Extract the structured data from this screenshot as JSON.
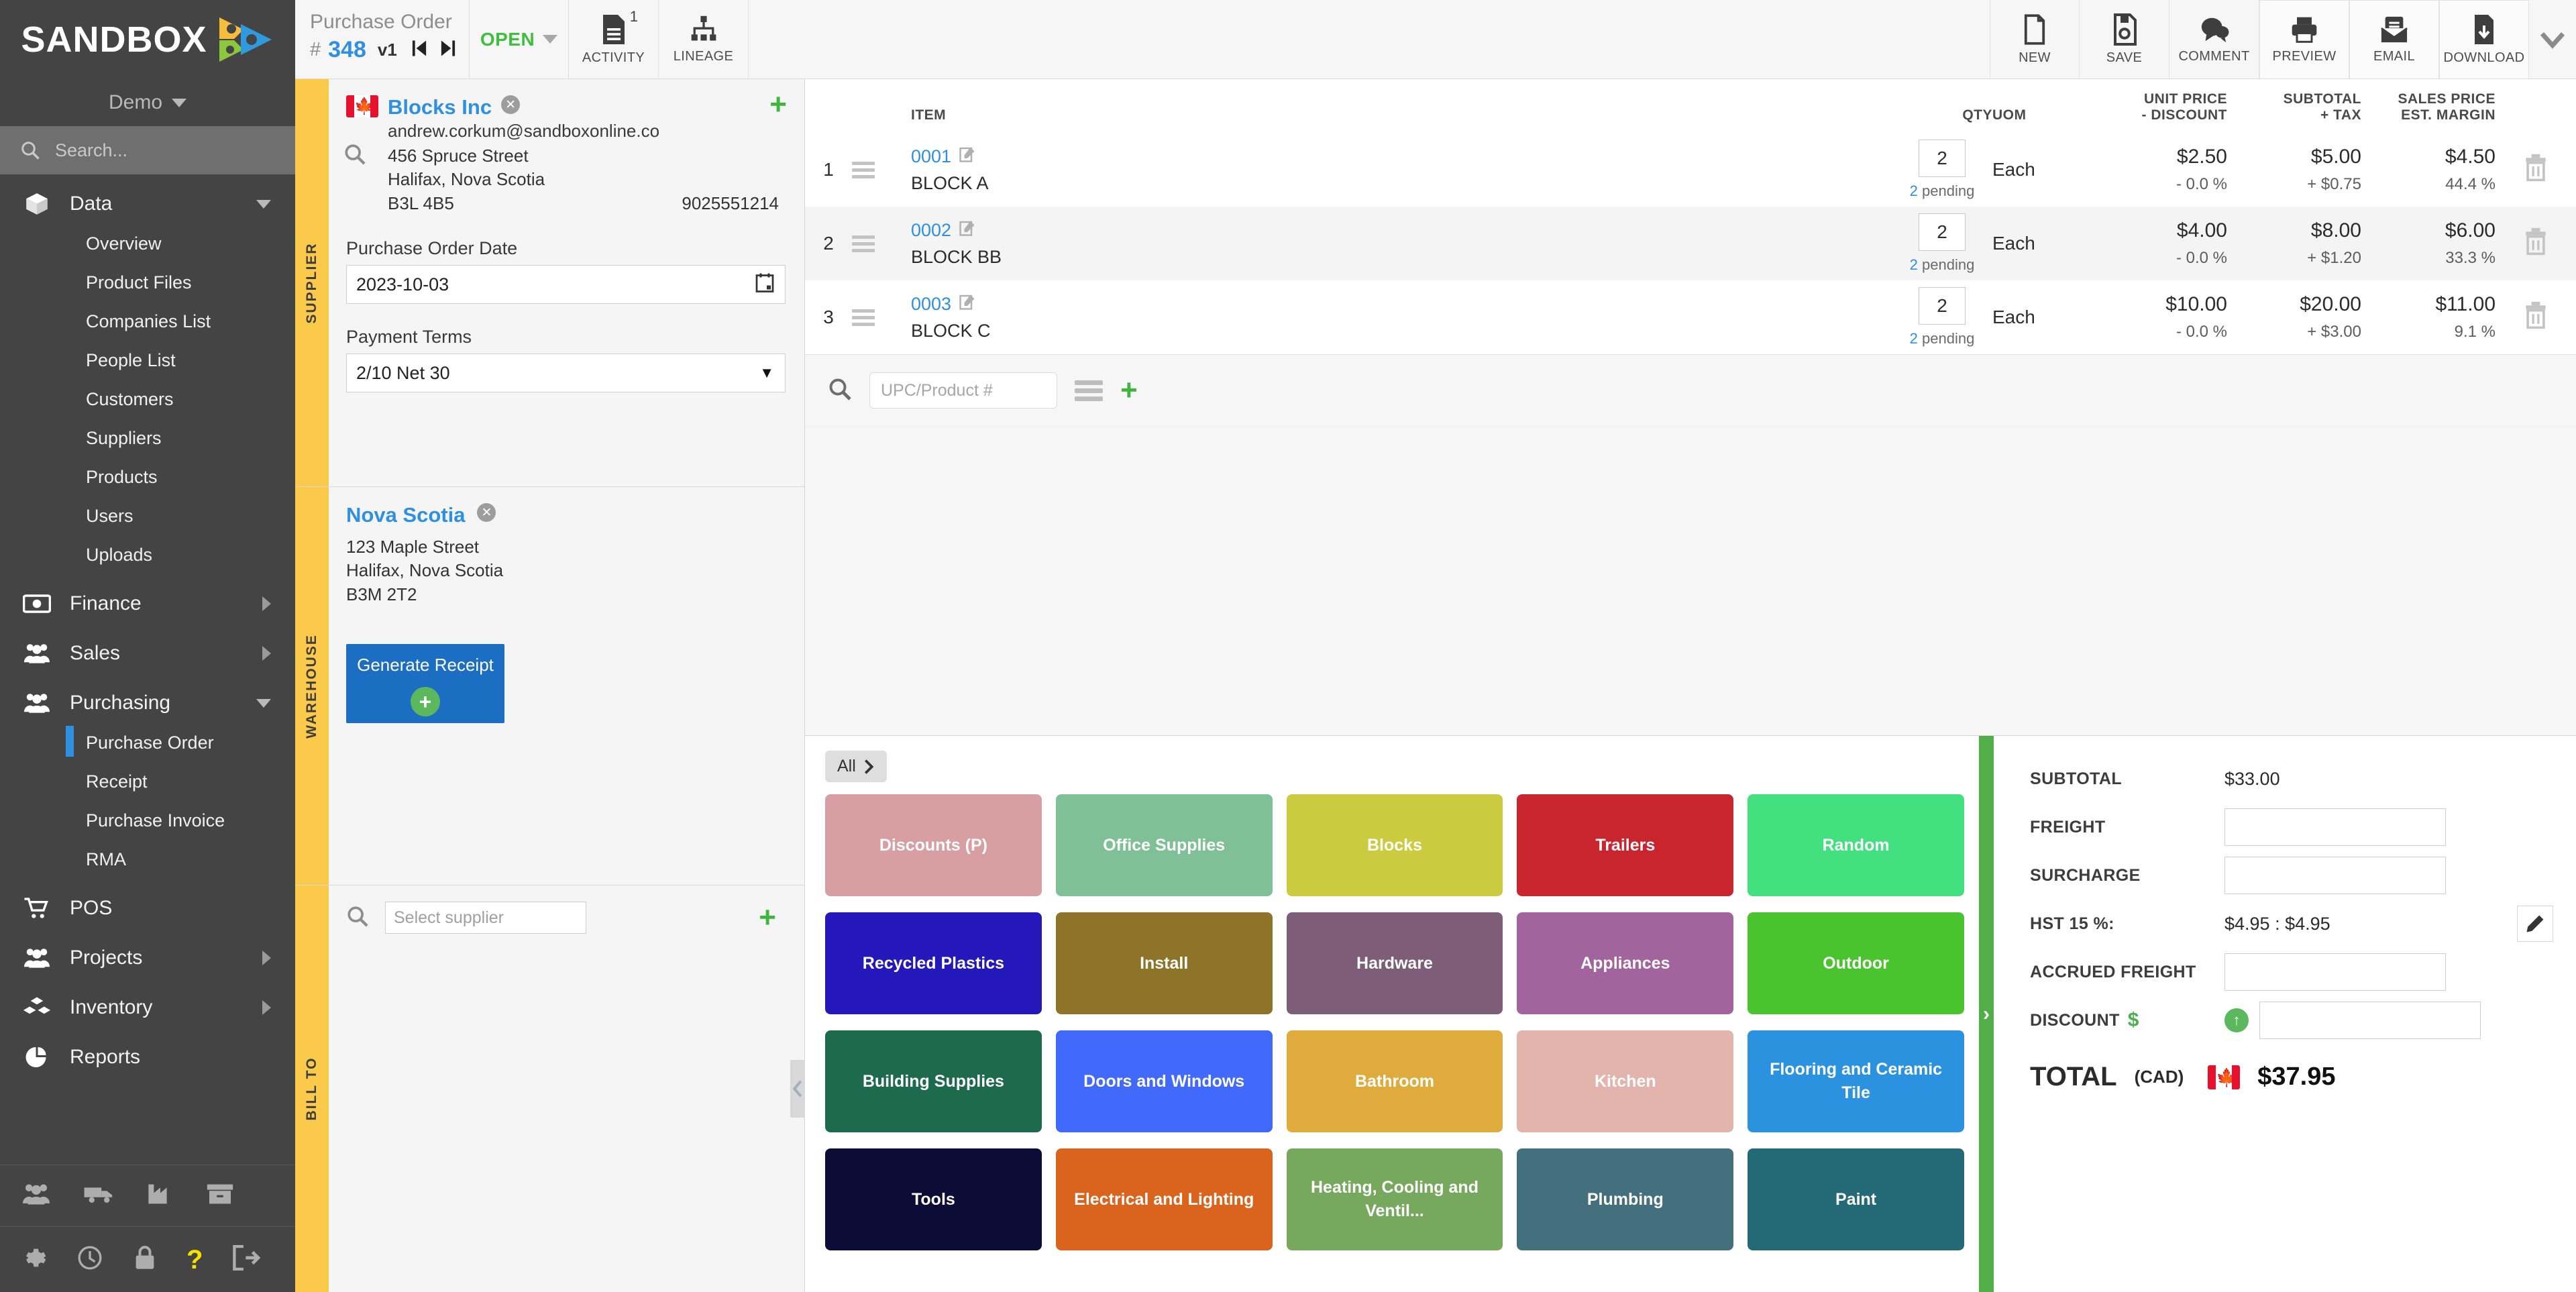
{
  "brand": {
    "name": "SANDBOX",
    "org": "Demo",
    "search_placeholder": "Search..."
  },
  "sidebar": {
    "groups": [
      {
        "label": "Data",
        "icon": "cube-icon",
        "expanded": true,
        "items": [
          "Overview",
          "Product Files",
          "Companies List",
          "People List",
          "Customers",
          "Suppliers",
          "Products",
          "Users",
          "Uploads"
        ]
      },
      {
        "label": "Finance",
        "icon": "banknote-icon",
        "expanded": false,
        "items": []
      },
      {
        "label": "Sales",
        "icon": "people-icon",
        "expanded": false,
        "items": []
      },
      {
        "label": "Purchasing",
        "icon": "people-icon",
        "expanded": true,
        "items": [
          "Purchase Order",
          "Receipt",
          "Purchase Invoice",
          "RMA"
        ],
        "active_item": "Purchase Order"
      },
      {
        "label": "POS",
        "icon": "cart-icon",
        "expanded": false,
        "items": []
      },
      {
        "label": "Projects",
        "icon": "people-icon",
        "expanded": false,
        "items": []
      },
      {
        "label": "Inventory",
        "icon": "boxes-icon",
        "expanded": false,
        "items": []
      },
      {
        "label": "Reports",
        "icon": "pie-chart-icon",
        "expanded": false,
        "items": []
      }
    ],
    "quick_icons": [
      "people-icon",
      "truck-icon",
      "factory-icon",
      "archive-box-icon"
    ],
    "bottom_icons": [
      "gear-icon",
      "clock-icon",
      "lock-icon",
      "question-icon",
      "logout-icon"
    ]
  },
  "topbar": {
    "doc_type": "Purchase Order",
    "hash": "#",
    "doc_number": "348",
    "version": "v1",
    "status": "OPEN",
    "buttons": [
      {
        "label": "ACTIVITY",
        "icon": "document-icon",
        "badge": "1"
      },
      {
        "label": "LINEAGE",
        "icon": "lineage-icon",
        "badge": ""
      },
      {
        "label": "NEW",
        "icon": "new-file-icon",
        "badge": ""
      },
      {
        "label": "SAVE",
        "icon": "save-disk-icon",
        "badge": ""
      },
      {
        "label": "COMMENT",
        "icon": "comment-icon",
        "badge": ""
      },
      {
        "label": "PREVIEW",
        "icon": "printer-icon",
        "badge": ""
      },
      {
        "label": "EMAIL",
        "icon": "email-icon",
        "badge": ""
      },
      {
        "label": "DOWNLOAD",
        "icon": "download-icon",
        "badge": ""
      }
    ]
  },
  "supplier": {
    "tab_label": "SUPPLIER",
    "flag": "canada-flag-icon",
    "name": "Blocks Inc",
    "email": "andrew.corkum@sandboxonline.co",
    "address1": "456 Spruce Street",
    "address2": "Halifax, Nova Scotia",
    "postal": "B3L 4B5",
    "phone": "9025551214",
    "po_date_label": "Purchase Order Date",
    "po_date": "2023-10-03",
    "payment_terms_label": "Payment Terms",
    "payment_terms": "2/10 Net 30"
  },
  "warehouse": {
    "tab_label": "WAREHOUSE",
    "name": "Nova Scotia",
    "address1": "123 Maple Street",
    "address2": "Halifax, Nova Scotia",
    "postal": "B3M 2T2",
    "generate_receipt_label": "Generate Receipt"
  },
  "billto": {
    "tab_label": "BILL TO",
    "select_supplier_placeholder": "Select supplier"
  },
  "items_table": {
    "headers": {
      "item": "ITEM",
      "qty": "QTY",
      "uom": "UOM",
      "unit_price_l1": "UNIT PRICE",
      "unit_price_l2": "- DISCOUNT",
      "subtotal_l1": "SUBTOTAL",
      "subtotal_l2": "+ TAX",
      "sales_l1": "SALES PRICE",
      "sales_l2": "EST. MARGIN"
    },
    "rows": [
      {
        "idx": "1",
        "code": "0001",
        "desc": "BLOCK A",
        "qty": "2",
        "pending_num": "2",
        "pending_text": " pending",
        "uom": "Each",
        "unit_price": "$2.50",
        "discount": "- 0.0 %",
        "subtotal": "$5.00",
        "tax": "+ $0.75",
        "sales_price": "$4.50",
        "margin": "44.4 %"
      },
      {
        "idx": "2",
        "code": "0002",
        "desc": "BLOCK BB",
        "qty": "2",
        "pending_num": "2",
        "pending_text": " pending",
        "uom": "Each",
        "unit_price": "$4.00",
        "discount": "- 0.0 %",
        "subtotal": "$8.00",
        "tax": "+ $1.20",
        "sales_price": "$6.00",
        "margin": "33.3 %"
      },
      {
        "idx": "3",
        "code": "0003",
        "desc": "BLOCK C",
        "qty": "2",
        "pending_num": "2",
        "pending_text": " pending",
        "uom": "Each",
        "unit_price": "$10.00",
        "discount": "- 0.0 %",
        "subtotal": "$20.00",
        "tax": "+ $3.00",
        "sales_price": "$11.00",
        "margin": "9.1 %"
      }
    ]
  },
  "upc_bar": {
    "placeholder": "UPC/Product #"
  },
  "categories": {
    "all_label": "All",
    "tiles": [
      {
        "label": "Discounts (P)",
        "color": "#d79fa2"
      },
      {
        "label": "Office Supplies",
        "color": "#7fc096"
      },
      {
        "label": "Blocks",
        "color": "#ccca3f"
      },
      {
        "label": "Trailers",
        "color": "#c9252f"
      },
      {
        "label": "Random",
        "color": "#42e07f"
      },
      {
        "label": "Recycled Plastics",
        "color": "#2518ba"
      },
      {
        "label": "Install",
        "color": "#8d7429"
      },
      {
        "label": "Hardware",
        "color": "#7d5d78"
      },
      {
        "label": "Appliances",
        "color": "#a2649c"
      },
      {
        "label": "Outdoor",
        "color": "#49c32e"
      },
      {
        "label": "Building Supplies",
        "color": "#1d6a4c"
      },
      {
        "label": "Doors and Windows",
        "color": "#4169fb"
      },
      {
        "label": "Bathroom",
        "color": "#dfab3c"
      },
      {
        "label": "Kitchen",
        "color": "#e2b4ab"
      },
      {
        "label": "Flooring and Ceramic Tile",
        "color": "#2a92df"
      },
      {
        "label": "Tools",
        "color": "#0c0c36"
      },
      {
        "label": "Electrical and Lighting",
        "color": "#da641e"
      },
      {
        "label": "Heating, Cooling and Ventil...",
        "color": "#76a85e"
      },
      {
        "label": "Plumbing",
        "color": "#44707e"
      },
      {
        "label": "Paint",
        "color": "#236a76"
      }
    ]
  },
  "totals": {
    "subtotal_label": "SUBTOTAL",
    "subtotal_value": "$33.00",
    "freight_label": "FREIGHT",
    "freight_value": "",
    "surcharge_label": "SURCHARGE",
    "surcharge_value": "",
    "hst_label": "HST 15 %:",
    "hst_value": "$4.95 : $4.95",
    "accrued_freight_label": "ACCRUED FREIGHT",
    "accrued_freight_value": "",
    "discount_label": "DISCOUNT",
    "discount_symbol": "$",
    "discount_value": "",
    "total_label": "TOTAL",
    "total_currency": "(CAD)",
    "total_value": "$37.95"
  }
}
